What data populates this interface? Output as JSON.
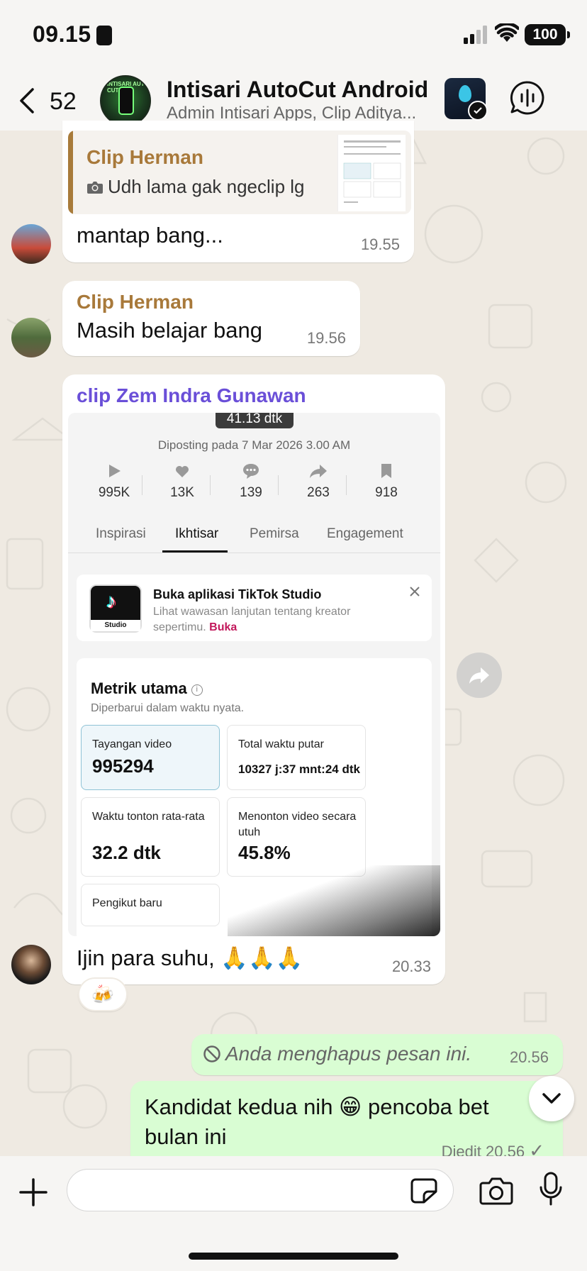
{
  "status_bar": {
    "time": "09.15",
    "battery": "100"
  },
  "header": {
    "back_count": "52",
    "group_name": "Intisari AutoCut Android",
    "members": "Admin Intisari Apps, Clip Aditya...",
    "group_avatar_text": "INTISARI AUTO CUT"
  },
  "messages": [
    {
      "quoted_sender": "Clip Herman",
      "quoted_text": "Udh lama gak ngeclip lg",
      "text": "mantap bang...",
      "time": "19.55"
    },
    {
      "sender": "Clip Herman",
      "text": "Masih belajar bang",
      "time": "19.56"
    },
    {
      "sender": "clip Zem Indra Gunawan",
      "text": "Ijin para suhu, 🙏🙏🙏",
      "time": "20.33",
      "reaction": "🍻"
    },
    {
      "deleted_text": "Anda menghapus pesan ini.",
      "time": "20.56"
    },
    {
      "text": "Kandidat kedua nih 😁 pencoba bet bulan ini",
      "edited_label": "Diedit",
      "time": "20.56",
      "tick": "✓"
    }
  ],
  "tiktok": {
    "duration": "41.13 dtk",
    "posted": "Diposting pada 7 Mar 2026 3.00 AM",
    "stats": [
      "995K",
      "13K",
      "139",
      "263",
      "918"
    ],
    "tabs": [
      "Inspirasi",
      "Ikhtisar",
      "Pemirsa",
      "Engagement"
    ],
    "promo_logo_label": "Studio",
    "promo_title": "Buka aplikasi TikTok Studio",
    "promo_desc": "Lihat wawasan lanjutan tentang kreator sepertimu.",
    "promo_link": "Buka",
    "card_title": "Metrik utama",
    "card_sub": "Diperbarui dalam waktu nyata.",
    "metrics": [
      {
        "label": "Tayangan video",
        "value": "995294"
      },
      {
        "label": "Total waktu putar",
        "value": "10327 j:37 mnt:24 dtk"
      },
      {
        "label": "Waktu tonton rata-rata",
        "value": "32.2 dtk"
      },
      {
        "label": "Menonton video secara utuh",
        "value": "45.8%"
      },
      {
        "label": "Pengikut baru",
        "value": ""
      }
    ]
  },
  "composer": {
    "placeholder": ""
  },
  "colors": {
    "background": "#efeae2",
    "outgoing_bubble": "#d9fdd3",
    "sender_brown": "#a8793a",
    "sender_purple": "#6a4fd8"
  }
}
